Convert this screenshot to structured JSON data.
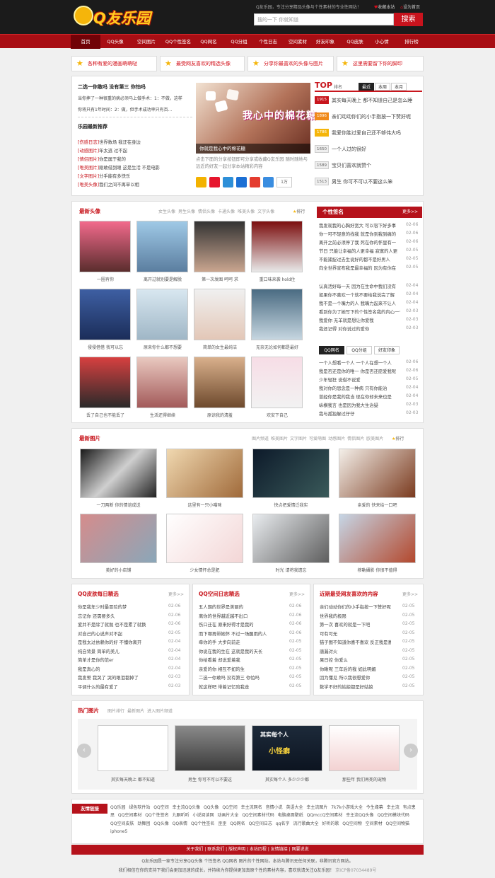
{
  "header": {
    "logo_text": "Q友乐园",
    "slogan": "Q友乐园，专注分享精品头像与个性素材的专业性网站！",
    "fav_label": "收藏本站",
    "set_home_label": "设为首页",
    "search_placeholder": "搜的一下 你就知道",
    "search_button": "搜索"
  },
  "nav": [
    "首页",
    "QQ头像",
    "空间图片",
    "QQ个性签名",
    "QQ网名",
    "QQ分组",
    "个性日志",
    "空间素材",
    "好友印象",
    "QQ皮肤",
    "小心情",
    "排行榜"
  ],
  "ads": [
    "各种有爱的漫画萌萌哒",
    "最受网友喜欢的精选头像",
    "分享你最喜欢的头像与图片",
    "这里需要留下你的脚印"
  ],
  "featured": {
    "headline": "二选一你敢吗 没有第三 你怕吗",
    "lines": [
      "当你摔了一种很重的病必须马上做手术：1：不做，这样",
      "你将只有1年时间：2：做，但手术成功率只有百..."
    ],
    "news_title": "乐园最新推荐",
    "news": [
      {
        "tag": "[伤感日志]",
        "text": "世界数场 我迂在身边"
      },
      {
        "tag": "[动感图片]",
        "text": "年太逃 过不起"
      },
      {
        "tag": "[情侣图片]",
        "text": "你是属于我的"
      },
      {
        "tag": "[唯美图片]",
        "text": "刚敢借到眼 这是生活 不是电影"
      },
      {
        "tag": "[文字图片]",
        "text": "分手能有多快乐"
      },
      {
        "tag": "[唯美头像]",
        "text": "我们之间不再单以相"
      }
    ]
  },
  "slide": {
    "art_title": "我心中的棉花糖",
    "caption": "你就是我心中的棉花糖",
    "desc": "点击下面的分享按钮即可分享或收藏Q友乐园 随时随地与远近的好友一起分享本站精彩内容",
    "share_count": "1万"
  },
  "top_rank": {
    "title": "TOP",
    "subtitle": "排名",
    "tabs": [
      "最近",
      "本周",
      "本月"
    ],
    "items": [
      {
        "n": "1915",
        "t": "其实每天晚上 都不知道自己是怎么睡"
      },
      {
        "n": "1896",
        "t": "亲们动动你们的小手指按一下赞好呢"
      },
      {
        "n": "1786",
        "t": "我爱你胜过爱自己还不够伟大吗"
      },
      {
        "n": "1650",
        "t": "一个人过的很好"
      },
      {
        "n": "1589",
        "t": "宝贝们喜欢就赞个"
      },
      {
        "n": "1513",
        "t": "男生 你可不可以不要这么笨"
      }
    ]
  },
  "avatars": {
    "title": "最新头像",
    "tabs": [
      "女生头像",
      "男生头像",
      "情侣头像",
      "卡通头像",
      "唯美头像",
      "文字头像"
    ],
    "rank_label": "排行",
    "items": [
      "一圈有你",
      "离开过就别要是解脱",
      "第一次发图 呵呵 求",
      "重口味来袭 hold住",
      "侵侵借借 我可以忘",
      "原来你什么都不想要",
      "简单的女生最纯洁",
      "无奈无论如何都是最好",
      "丢了自己也不能丢了",
      "生活还得继续",
      "原谅我的清羞",
      "欢安下自己"
    ]
  },
  "signatures": {
    "title": "个性签名",
    "more": "更多>>",
    "items": [
      {
        "t": "我发现我的心胸好宽大 可以容下好多事",
        "d": "02-06"
      },
      {
        "t": "你一可不轻意的找我 就是你到我到痛的",
        "d": "02-06"
      },
      {
        "t": "离开之前必须停了我 死在你的怀里有一",
        "d": "02-06"
      },
      {
        "t": "节日 只能让幸福的人更幸福 寂寞的人更",
        "d": "02-05"
      },
      {
        "t": "不能捕捉过去生说好的都不是好男人",
        "d": "02-05"
      },
      {
        "t": "向全世界宣布我是最幸福的 因为有你在",
        "d": "02-05"
      },
      {
        "t": "认真活好每一天 因为在生命中我们没有",
        "d": "02-04"
      },
      {
        "t": "如果你不喜欢一个就不要给我说完了解",
        "d": "02-04"
      },
      {
        "t": "我不是一个嘴力的人 我嘴力起来不让人",
        "d": "02-04"
      },
      {
        "t": "看到你为了她写下的个性签名我的内心一个劲",
        "d": "02-03"
      },
      {
        "t": "我爱你 无羊就是想让你爱我",
        "d": "02-03"
      },
      {
        "t": "我还记得 对你说过的爱你",
        "d": "02-03"
      }
    ]
  },
  "qq_tabs": {
    "tabs": [
      "QQ网名",
      "QQ分组",
      "好友印象"
    ],
    "items": [
      {
        "t": "一个人想看一个人 一个人在想一个人",
        "d": "02-06"
      },
      {
        "t": "我是否还是你的唯一 你是否还愿爱我呢",
        "d": "02-06"
      },
      {
        "t": "少年轻狂 说借不说爱",
        "d": "02-05"
      },
      {
        "t": "我对你的思念是一种病 只有你能治",
        "d": "02-04"
      },
      {
        "t": "曾经你是我的我当 现在你却未来也是",
        "d": "02-04"
      },
      {
        "t": "纵横我言 也是因为我大生治疑",
        "d": "02-03"
      },
      {
        "t": "我与孤独躲过仔仔",
        "d": "02-03"
      }
    ]
  },
  "photos": {
    "title": "最新图片",
    "tabs": [
      "图片频道",
      "唯美图片",
      "文字图片",
      "可爱萌图",
      "动感图片",
      "情侣图片",
      "欧美图片"
    ],
    "rank_label": "排行",
    "items": [
      "一刀两断 你的情谊成送",
      "这里有一只小喵咪",
      "快点把爱情迁我实",
      "亲爱的 快来给一口吧",
      "美好的小店铺",
      "少女情怀总是肥",
      "时光 请将我遗忘",
      "移動攝影 你很不值得"
    ]
  },
  "skins": {
    "title": "QQ皮肤每日精选",
    "more": "更多>>",
    "items": [
      {
        "t": "你是我年少时最冒险的梦",
        "d": "02-06"
      },
      {
        "t": "忘记你 还需要多久",
        "d": "02-06"
      },
      {
        "t": "爱并不是除了就抛 也不是累了就换",
        "d": "02-06"
      },
      {
        "t": "对自己的心说声对不起",
        "d": "02-05"
      },
      {
        "t": "是我太过依赖你的好 不懂你离开",
        "d": "02-04"
      },
      {
        "t": "纯自背景 简单的美儿",
        "d": "02-04"
      },
      {
        "t": "简单才是你的范er",
        "d": "02-04"
      },
      {
        "t": "我是真心的",
        "d": "02-04"
      },
      {
        "t": "我发誓 我哭了 哭的眼泪都掉了",
        "d": "02-03"
      },
      {
        "t": "平调什么的最有爱了",
        "d": "02-03"
      }
    ]
  },
  "diary": {
    "title": "QQ空间日志精选",
    "more": "更多>>",
    "items": [
      {
        "t": "五人期的世界是美丽的",
        "d": "02-06"
      },
      {
        "t": "离你的世界越近越不出口",
        "d": "02-06"
      },
      {
        "t": "伤口迁在 原来好得才是我的",
        "d": "02-06"
      },
      {
        "t": "而下哪再带她怀 不过一场醒雨的人",
        "d": "02-06"
      },
      {
        "t": "牵你的手 大步向前走",
        "d": "02-05"
      },
      {
        "t": "你说在我的生在 这就是我的天长",
        "d": "02-05"
      },
      {
        "t": "你给看着 却说爱着我",
        "d": "02-05"
      },
      {
        "t": "亲爱的你 相互不如的生",
        "d": "02-05"
      },
      {
        "t": "二选一你敢吗 没有第三 你怕吗",
        "d": "02-05"
      },
      {
        "t": "就这样吧 带着记忆陪我走",
        "d": "02-05"
      }
    ]
  },
  "popular": {
    "title": "近期最受网友喜欢的内容",
    "more": "更多>>",
    "items": [
      {
        "t": "亲们动动你们的小手指按一下赞好呢",
        "d": "02-05"
      },
      {
        "t": "世界我的极限",
        "d": "02-05"
      },
      {
        "t": "第一次 喜欢的就是一下吧",
        "d": "02-05"
      },
      {
        "t": "可有可无",
        "d": "02-05"
      },
      {
        "t": "猫子图不知道你喜不喜欢 反正我是喜欢",
        "d": "02-05"
      },
      {
        "t": "唐漏对火",
        "d": "02-05"
      },
      {
        "t": "果日控 你爱么",
        "d": "02-05"
      },
      {
        "t": "你瞅呢 三年后的我 如此明媚",
        "d": "02-05"
      },
      {
        "t": "因为懂见 所以我很想爱你",
        "d": "02-05"
      },
      {
        "t": "数学不好的姑娘都是好姑娘",
        "d": "02-05"
      }
    ]
  },
  "hot": {
    "title": "热门图片",
    "links": [
      "图片排行",
      "最新图片",
      "进入图片频道"
    ],
    "items": [
      "其实每天晚上 都不知道",
      "男生 你可不可以不要这",
      "其实每个人 多少少少都",
      "那些年 我们再死的宠物"
    ],
    "art_texts": [
      "其实每个人",
      "小怪癖"
    ]
  },
  "links": {
    "title": "友情链接",
    "items": "QQ乐园 绿色软件站 QQ空间 幸主流QQ头像 QQ头像 QQ空间 幸主流网名 音情小说 英语大全 幸主流图片 7k7k小游戏大全 今生缘幕 幸主流 有点患思 QQ空间素材 QQ个性签名 九酮听听 小说阅读网 动画片大全 QQ空间素材代码 电脑桌面壁纸 QQmccQ空间素材 幸主流QQ头像 QQ空间模块代码 QQ空间皮肤 劲舞团 QQ头像 QQ表情 QQ个性签名 歪歪 QQ网名 QQ空间日志 qq名字 流行歌曲大全 好听的歌 QQ空间物 空间素材 QQ空间物猫 iphone5"
  },
  "footer": {
    "links": [
      "关于我们",
      "联系我们",
      "版权声明",
      "本站历程",
      "友情链接",
      "网要说说"
    ],
    "line1": "Q友乐园是一家专注分享QQ头像 个性签名 QQ网名 图片的个性网站，本站与腾讯无任何关联，非腾讯官方网站。",
    "line2": "我们相信在你的支持下我们会更加迅速的成长，并持续为你提供更加真原个性的素材内容，喜欢就请关注Q友乐园！",
    "icp": "京ICP备07034489号"
  },
  "colors": {
    "brand_red": "#b5121b",
    "header_bg": "#1b1b1b",
    "accent_yellow": "#f5b50a"
  }
}
